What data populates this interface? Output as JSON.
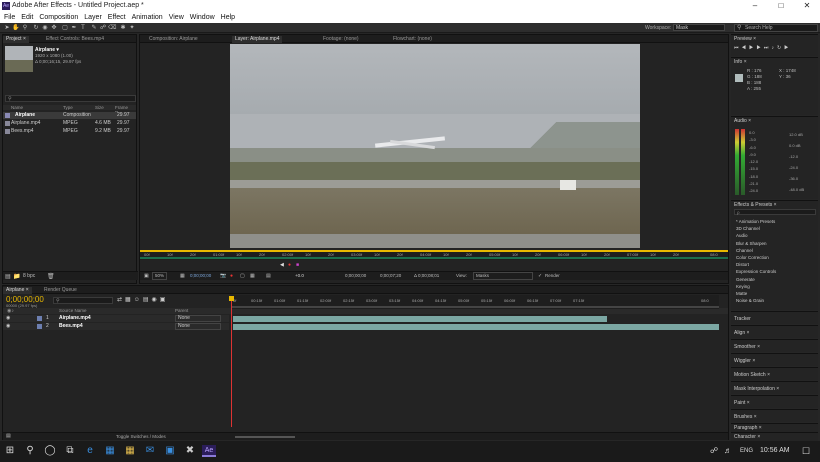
{
  "app": {
    "title": "Adobe After Effects - Untitled Project.aep *",
    "logo": "Ae"
  },
  "menu": [
    "File",
    "Edit",
    "Composition",
    "Layer",
    "Effect",
    "Animation",
    "View",
    "Window",
    "Help"
  ],
  "toolbar": {
    "workspace_label": "Workspace:",
    "workspace_value": "Mask",
    "search_placeholder": "Search Help"
  },
  "project": {
    "tabs": [
      "Project ×",
      "Effect Controls: Bees.mp4"
    ],
    "selected_name": "Airplane ▾",
    "selected_info1": "1920 x 1080 (1.00)",
    "selected_info2": "Δ 0;00;16;15, 29.97 fps",
    "columns": [
      "Name",
      "Type",
      "Size",
      "Frame R..."
    ],
    "items": [
      {
        "name": "Airplane",
        "type": "Composition",
        "size": "",
        "fr": "29.97"
      },
      {
        "name": "Airplane.mp4",
        "type": "MPEG",
        "size": "4.6 MB",
        "fr": "29.97"
      },
      {
        "name": "Bees.mp4",
        "type": "MPEG",
        "size": "9.2 MB",
        "fr": "29.97"
      }
    ],
    "bpc": "8 bpc"
  },
  "viewer": {
    "tabs": [
      "Composition: Airplane",
      "Layer: Airplane.mp4",
      "Footage: (none)",
      "Flowchart: (none)"
    ],
    "ruler": [
      "00f",
      "10f",
      "20f",
      "01:00f",
      "10f",
      "20f",
      "02:00f",
      "10f",
      "20f",
      "03:00f",
      "10f",
      "20f",
      "04:00f",
      "10f",
      "20f",
      "05:00f",
      "10f",
      "20f",
      "06:00f",
      "10f",
      "20f",
      "07:00f",
      "10f",
      "20f",
      "08:0"
    ],
    "controls": {
      "zoom": "50%",
      "timecode": "0;00;00;00",
      "in": "0;00;00;00",
      "out": "0;00;07;20",
      "duration": "Δ 0;00;08;01",
      "view_label": "View:",
      "view_value": "Masks",
      "render_label": "Render",
      "res": "+0.0"
    }
  },
  "timeline": {
    "tabs": [
      "Airplane ×",
      "Render Queue"
    ],
    "timecode": "0;00;00;00",
    "fps_info": "00000 (29.97 fps)",
    "columns": {
      "source": "Source Name",
      "parent": "Parent"
    },
    "layers": [
      {
        "num": "1",
        "name": "Airplane.mp4",
        "parent": "None"
      },
      {
        "num": "2",
        "name": "Bees.mp4",
        "parent": "None"
      }
    ],
    "ruler": [
      "0f",
      "00:15f",
      "01:00f",
      "01:15f",
      "02:00f",
      "02:15f",
      "03:00f",
      "03:15f",
      "04:00f",
      "04:15f",
      "05:00f",
      "05:15f",
      "06:00f",
      "06:15f",
      "07:00f",
      "07:15f",
      "08:0"
    ],
    "toggle_label": "Toggle Switches / Modes",
    "layer1_end_fraction": 0.78
  },
  "right_panels": {
    "preview": "Preview ×",
    "info": "Info ×",
    "info_values": {
      "r": "R : 176",
      "g": "G : 188",
      "b": "B : 188",
      "a": "A : 255",
      "x": "X : 1748",
      "y": "Y : 36"
    },
    "audio": "Audio ×",
    "audio_left": [
      "0.0",
      "-3.0",
      "-6.0",
      "-9.0",
      "-12.0",
      "-15.0",
      "-18.0",
      "-21.0",
      "-24.0"
    ],
    "audio_right": [
      "12.0 dB",
      "0.0 dB",
      "-12.0",
      "-24.0",
      "-36.0",
      "-48.0 dB"
    ],
    "effects": "Effects & Presets ×",
    "effects_search": "ρ",
    "effects_list": [
      "* Animation Presets",
      "3D Channel",
      "Audio",
      "Blur & Sharpen",
      "Channel",
      "Color Correction",
      "Distort",
      "Expression Controls",
      "Generate",
      "Keying",
      "Matte",
      "Noise & Grain"
    ],
    "collapsed": [
      "Tracker",
      "Align ×",
      "Smoother ×",
      "Wiggler ×",
      "Motion Sketch ×",
      "Mask Interpolation ×",
      "Paint ×",
      "Brushes ×",
      "Paragraph ×",
      "Character ×"
    ]
  },
  "taskbar": {
    "time": "10:56 AM",
    "lang": "ENG"
  },
  "colors": {
    "accent": "#e8b800",
    "bar": "#7ba7a3",
    "cti": "#d33"
  }
}
